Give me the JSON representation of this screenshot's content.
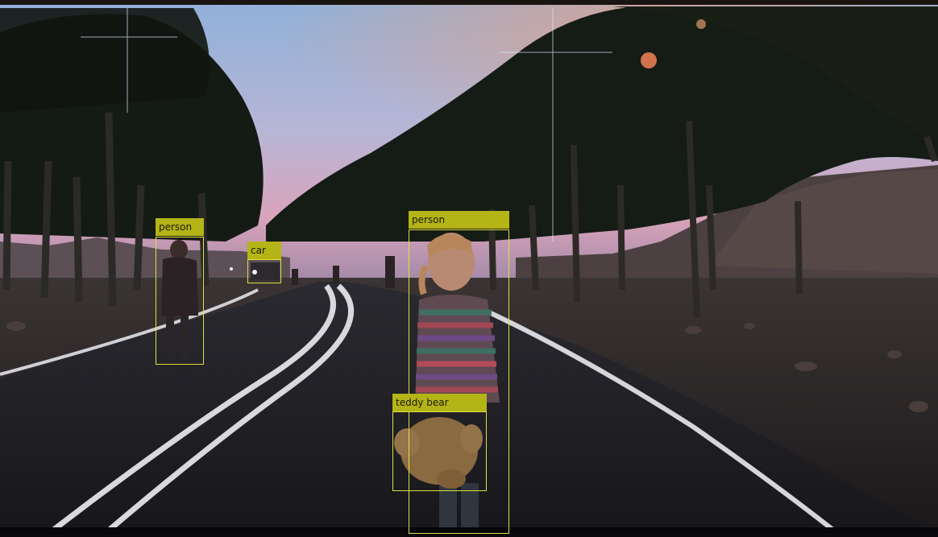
{
  "detections": [
    {
      "id": "person-left",
      "label": "person"
    },
    {
      "id": "car",
      "label": "car"
    },
    {
      "id": "person-child",
      "label": "person"
    },
    {
      "id": "teddy-bear",
      "label": "teddy bear"
    }
  ],
  "colors": {
    "box_outline": "#e0e040",
    "label_background": "#b4b416",
    "label_text": "#1a1a0a"
  }
}
